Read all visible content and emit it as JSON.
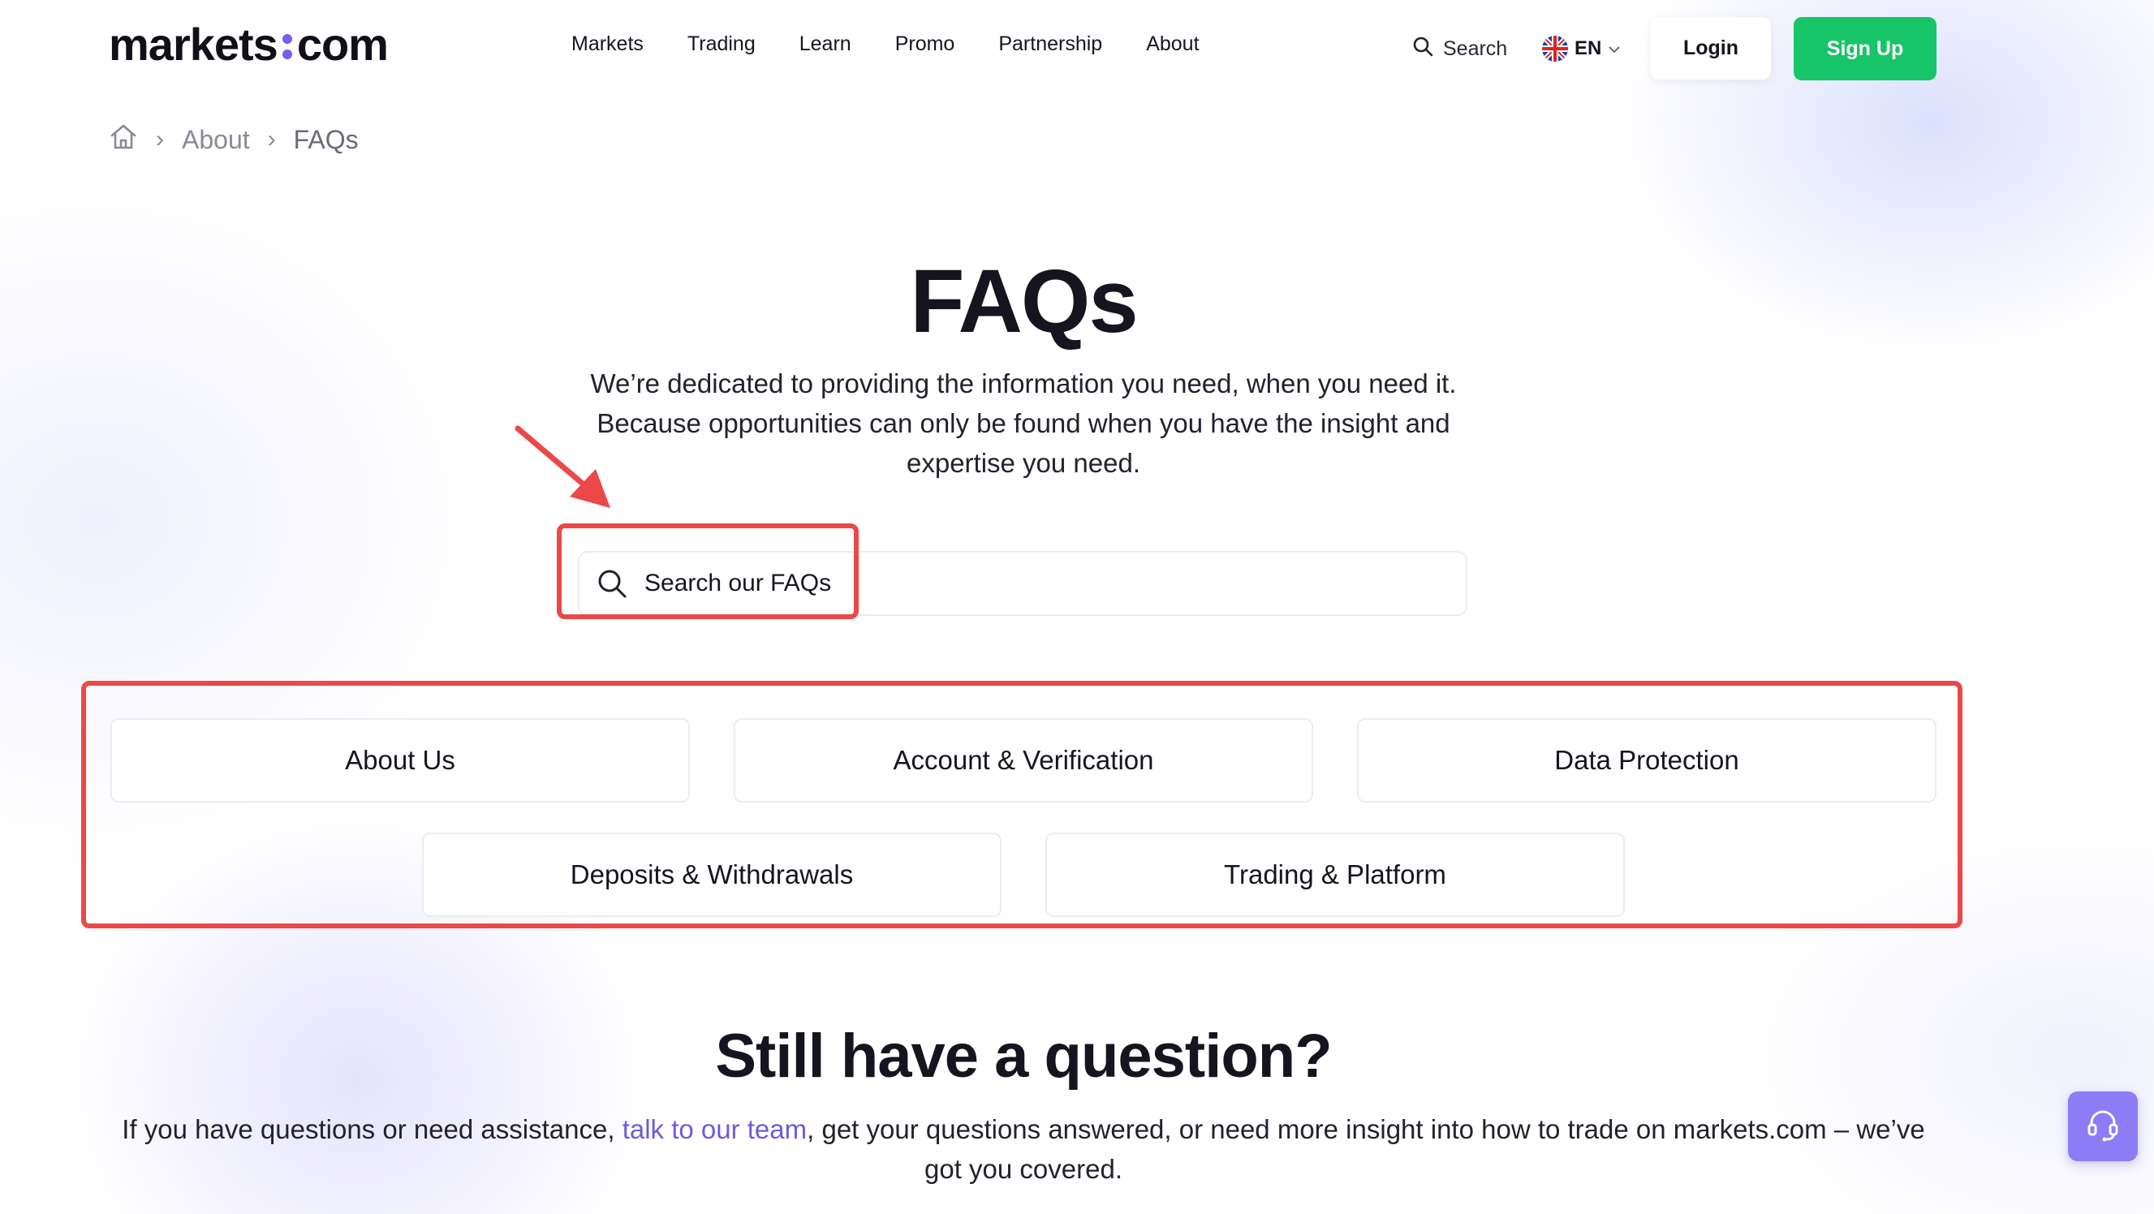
{
  "header": {
    "logo_left": "markets",
    "logo_right": "com",
    "nav": [
      "Markets",
      "Trading",
      "Learn",
      "Promo",
      "Partnership",
      "About"
    ],
    "search_label": "Search",
    "lang_label": "EN",
    "login_label": "Login",
    "signup_label": "Sign Up"
  },
  "breadcrumb": {
    "items": [
      "About",
      "FAQs"
    ]
  },
  "hero": {
    "title": "FAQs",
    "intro_line1": "We’re dedicated to providing the information you need, when you need it.",
    "intro_line2": "Because opportunities can only be found when you have the insight and",
    "intro_line3": "expertise you need.",
    "search_placeholder": "Search our FAQs"
  },
  "categories": [
    "About Us",
    "Account & Verification",
    "Data Protection",
    "Deposits & Withdrawals",
    "Trading & Platform"
  ],
  "contact": {
    "title": "Still have a question?",
    "text_before": "If you have questions or need assistance, ",
    "link_text": "talk to our team",
    "text_after": ", get your questions answered, or need more insight into how to trade on markets.com – we’ve got you covered."
  },
  "colors": {
    "brand_green": "#18c468",
    "brand_purple": "#7a5cf0",
    "annotation_red": "#eb4848",
    "link": "#6b5ce0"
  },
  "icons": {
    "home": "home-icon",
    "search": "search-icon",
    "chevron": "chevron-down-icon",
    "support": "headset-icon",
    "annotation": "red-arrow-icon"
  }
}
